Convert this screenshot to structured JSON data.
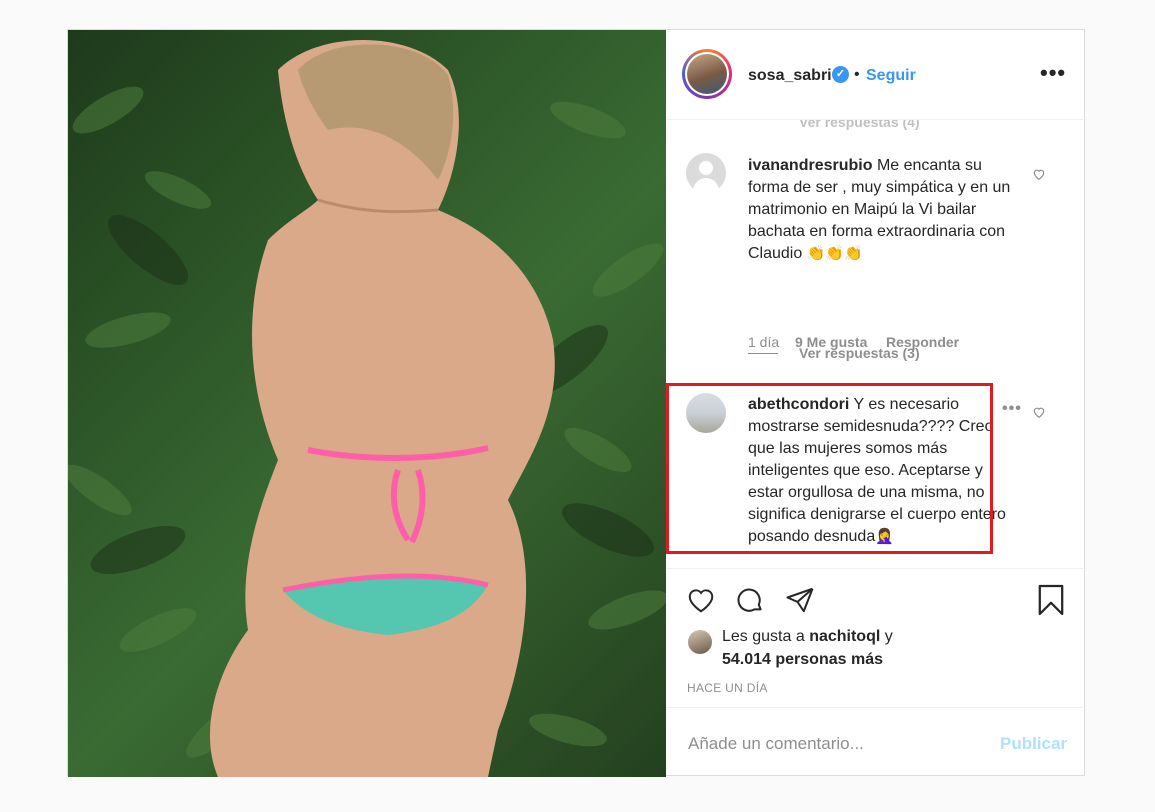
{
  "post": {
    "username": "sosa_sabri",
    "verified_mark": "✓",
    "separator": "•",
    "follow_label": "Seguir",
    "more_label": "•••"
  },
  "comments": {
    "faded_replies": "Ver respuestas (4)",
    "items": [
      {
        "username": "ivanandresrubio",
        "text": "Me encanta su forma de ser , muy simpática y en un matrimonio en Maipú la Vi bailar bachata en forma extraordinaria con Claudio",
        "emoji": "👏👏👏",
        "time": "1 día",
        "likes": "9 Me gusta",
        "reply": "Responder",
        "view_replies": "Ver respuestas (3)"
      },
      {
        "username": "abethcondori",
        "text": "Y es necesario mostrarse semidesnuda???? Creo que las mujeres somos más inteligentes que eso. Aceptarse y estar orgullosa de una misma, no significa denigrarse el cuerpo entero posando desnuda",
        "emoji": "🤦‍♀️",
        "more_label": "•••"
      }
    ]
  },
  "likes": {
    "prefix": "Les gusta a",
    "user": "nachitoql",
    "suffix": "y",
    "others": "54.014 personas más"
  },
  "time_ago": "HACE UN DÍA",
  "add_comment": {
    "placeholder": "Añade un comentario...",
    "publish_label": "Publicar"
  },
  "icons": [
    "heart-icon",
    "comment-icon",
    "share-icon",
    "bookmark-icon",
    "verified-icon"
  ],
  "colors": {
    "link": "#3897f0",
    "publish_disabled": "#b2dffc",
    "highlight": "#e21b23",
    "muted": "#8e8e8e"
  }
}
